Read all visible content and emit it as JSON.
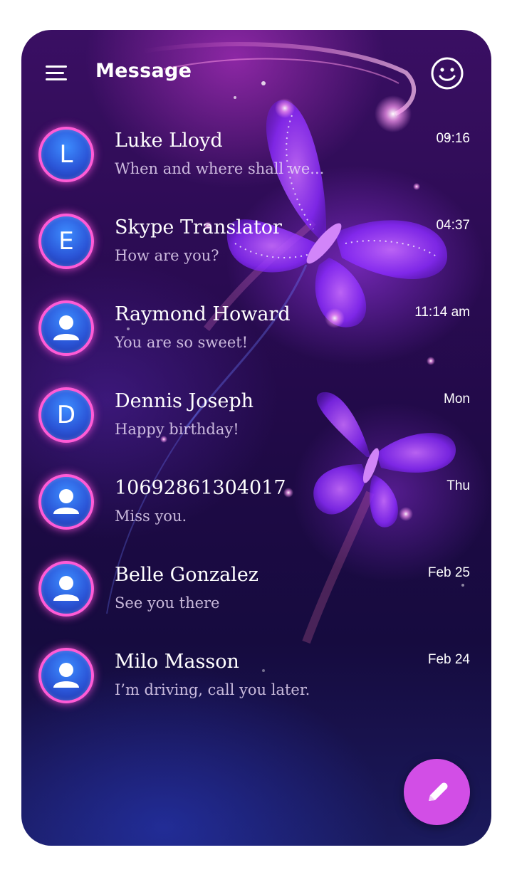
{
  "header": {
    "title": "Message",
    "menu_icon": "hamburger-menu-icon",
    "emoji_icon": "smiley-face-icon"
  },
  "conversations": [
    {
      "avatar_type": "letter",
      "avatar_letter": "L",
      "name": "Luke Lloyd",
      "preview": "When and where shall we...",
      "time": "09:16"
    },
    {
      "avatar_type": "letter",
      "avatar_letter": "E",
      "name": "Skype Translator",
      "preview": "How are you?",
      "time": "04:37"
    },
    {
      "avatar_type": "person",
      "avatar_letter": "",
      "name": "Raymond Howard",
      "preview": "You are so sweet!",
      "time": "11:14 am"
    },
    {
      "avatar_type": "letter",
      "avatar_letter": "D",
      "name": "Dennis Joseph",
      "preview": "Happy birthday!",
      "time": "Mon"
    },
    {
      "avatar_type": "person",
      "avatar_letter": "",
      "name": "10692861304017",
      "preview": "Miss you.",
      "time": "Thu"
    },
    {
      "avatar_type": "person",
      "avatar_letter": "",
      "name": "Belle Gonzalez",
      "preview": "See you there",
      "time": "Feb 25"
    },
    {
      "avatar_type": "person",
      "avatar_letter": "",
      "name": "Milo Masson",
      "preview": "I’m driving, call you later.",
      "time": "Feb 24"
    }
  ],
  "fab": {
    "icon": "pencil-compose-icon",
    "color": "#d24ee6"
  },
  "colors": {
    "avatar_ring": "#ff5bd6",
    "avatar_fill": "#2b56d8",
    "background_top": "#3a0f63",
    "background_bottom": "#1a1a5c"
  }
}
